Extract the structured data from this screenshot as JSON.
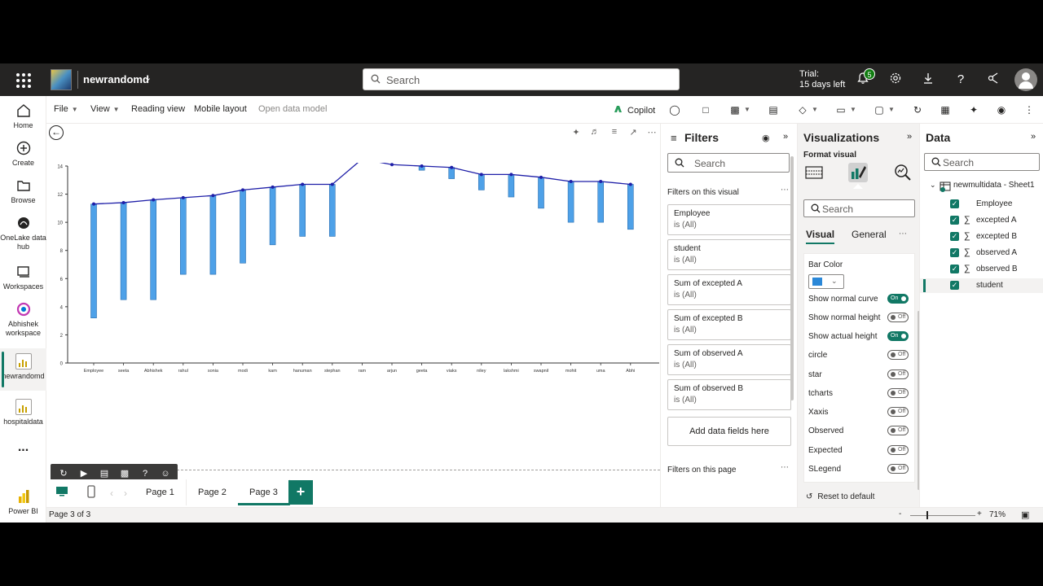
{
  "topbar": {
    "workspace_name": "newrandomd",
    "search_placeholder": "Search",
    "trial_line1": "Trial:",
    "trial_line2": "15 days left",
    "notification_count": "5"
  },
  "leftnav": {
    "home": "Home",
    "create": "Create",
    "browse": "Browse",
    "onelake": "OneLake data hub",
    "workspaces": "Workspaces",
    "abhishek": "Abhishek workspace",
    "newrandomd": "newrandomd",
    "hospitaldata": "hospitaldata",
    "more": "...",
    "powerbi": "Power BI"
  },
  "ribbon": {
    "file": "File",
    "view": "View",
    "reading_view": "Reading view",
    "mobile_layout": "Mobile layout",
    "open_data_model": "Open data model",
    "copilot": "Copilot"
  },
  "chart_data": {
    "type": "line",
    "categories": [
      "Employee",
      "seeta",
      "Abhishek",
      "rahul",
      "sonia",
      "modi",
      "kam",
      "hanuman",
      "stephan",
      "ram",
      "arjun",
      "geeta",
      "viaks",
      "niley",
      "lakshmi",
      "swapnil",
      "mohit",
      "uma",
      "Abhi"
    ],
    "series": [
      {
        "values": [
          11.3,
          11.4,
          11.6,
          11.75,
          11.9,
          12.3,
          12.5,
          12.7,
          12.7,
          14.5,
          14.1,
          14.0,
          13.9,
          13.4,
          13.4,
          13.2,
          12.9,
          12.9,
          12.7
        ]
      }
    ],
    "bar_bottoms": [
      3.2,
      4.5,
      4.5,
      6.3,
      6.3,
      7.1,
      8.4,
      9.0,
      9.0,
      null,
      null,
      13.7,
      13.1,
      12.3,
      11.8,
      11.0,
      10.0,
      10.0,
      9.5
    ],
    "ylim": [
      0,
      14
    ],
    "yticks": [
      0,
      2,
      4,
      6,
      8,
      10,
      12,
      14
    ],
    "bar_color": "#4ea1e8",
    "line_color": "#1f1fa8"
  },
  "pages": {
    "tabs": [
      "Page 1",
      "Page 2",
      "Page 3"
    ],
    "active": "Page 3",
    "add": "+"
  },
  "status": {
    "page_info": "Page 3 of 3",
    "zoom": "71%",
    "zoom_minus": "-",
    "zoom_plus": "+"
  },
  "filters": {
    "title": "Filters",
    "search_placeholder": "Search",
    "on_visual": "Filters on this visual",
    "cards": [
      {
        "name": "Employee",
        "value": "is (All)"
      },
      {
        "name": "student",
        "value": "is (All)"
      },
      {
        "name": "Sum of excepted A",
        "value": "is (All)"
      },
      {
        "name": "Sum of excepted B",
        "value": "is (All)"
      },
      {
        "name": "Sum of observed A",
        "value": "is (All)"
      },
      {
        "name": "Sum of observed B",
        "value": "is (All)"
      }
    ],
    "add_fields": "Add data fields here",
    "on_page": "Filters on this page"
  },
  "viz": {
    "title": "Visualizations",
    "format_visual": "Format visual",
    "search_placeholder": "Search",
    "tab_visual": "Visual",
    "tab_general": "General",
    "bar_color_label": "Bar Color",
    "bar_color": "#2b88d8",
    "toggles": [
      {
        "label": "Show normal curve",
        "state": "On"
      },
      {
        "label": "Show normal height",
        "state": "Off"
      },
      {
        "label": "Show actual height",
        "state": "On"
      },
      {
        "label": "circle",
        "state": "Off"
      },
      {
        "label": "star",
        "state": "Off"
      },
      {
        "label": "tcharts",
        "state": "Off"
      },
      {
        "label": "Xaxis",
        "state": "Off"
      },
      {
        "label": "Observed",
        "state": "Off"
      },
      {
        "label": "Expected",
        "state": "Off"
      },
      {
        "label": "SLegend",
        "state": "Off"
      }
    ],
    "reset": "Reset to default"
  },
  "data_pane": {
    "title": "Data",
    "search_placeholder": "Search",
    "table": "newmultidata - Sheet1",
    "fields": [
      {
        "name": "Employee",
        "sigma": false
      },
      {
        "name": "excepted A",
        "sigma": true
      },
      {
        "name": "excepted B",
        "sigma": true
      },
      {
        "name": "observed A",
        "sigma": true
      },
      {
        "name": "observed B",
        "sigma": true
      },
      {
        "name": "student",
        "sigma": false
      }
    ]
  },
  "colors": {
    "accent": "#117865",
    "topbar": "#252423"
  }
}
